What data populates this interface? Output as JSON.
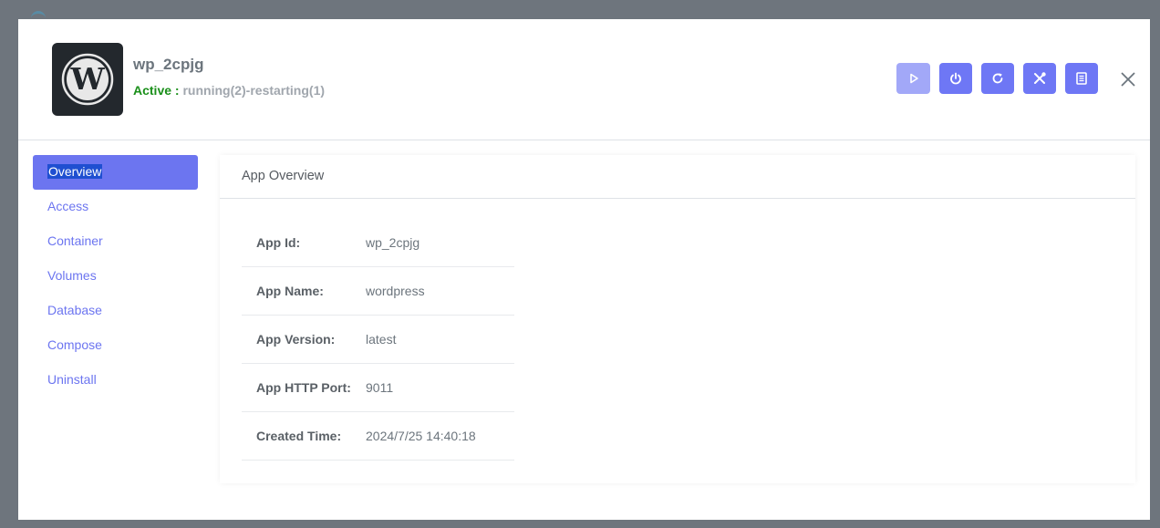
{
  "app": {
    "name": "wp_2cpjg",
    "status_label": "Active :",
    "status_detail": "running(2)-restarting(1)",
    "logo_icon": "wordpress-logo"
  },
  "toolbar": {
    "buttons": [
      {
        "name": "start-button",
        "icon": "play-icon"
      },
      {
        "name": "stop-button",
        "icon": "power-icon"
      },
      {
        "name": "restart-button",
        "icon": "refresh-icon"
      },
      {
        "name": "rebuild-button",
        "icon": "tools-icon"
      },
      {
        "name": "logs-button",
        "icon": "document-icon"
      }
    ],
    "close_icon": "close-icon"
  },
  "sidebar": {
    "items": [
      {
        "label": "Overview",
        "active": true
      },
      {
        "label": "Access"
      },
      {
        "label": "Container"
      },
      {
        "label": "Volumes"
      },
      {
        "label": "Database"
      },
      {
        "label": "Compose"
      },
      {
        "label": "Uninstall"
      }
    ]
  },
  "overview": {
    "title": "App Overview",
    "rows": [
      {
        "key": "App Id:",
        "value": "wp_2cpjg"
      },
      {
        "key": "App Name:",
        "value": "wordpress"
      },
      {
        "key": "App Version:",
        "value": "latest"
      },
      {
        "key": "App HTTP Port:",
        "value": "9011"
      },
      {
        "key": "Created Time:",
        "value": "2024/7/25 14:40:18"
      }
    ]
  },
  "colors": {
    "accent": "#6c75f0",
    "accent_disabled": "#a2a8f8",
    "status_active": "#1a8f1a",
    "backdrop": "#6e757d"
  }
}
